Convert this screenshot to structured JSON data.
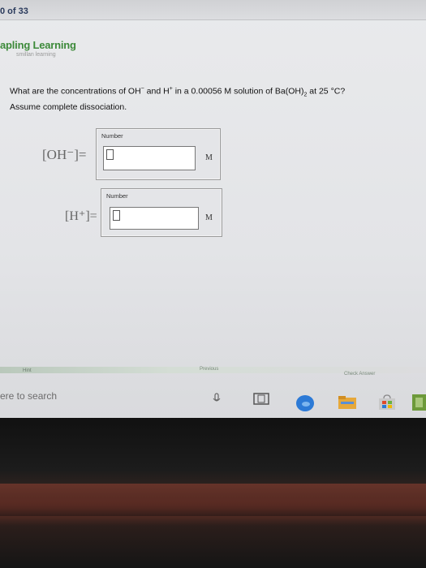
{
  "header": {
    "counter": "0 of 33"
  },
  "brand": {
    "name": "apling Learning",
    "sub": "smillan learning"
  },
  "question": {
    "text_a": "What are the concentrations of OH",
    "sup_a": "−",
    "text_b": " and H",
    "sup_b": "+",
    "text_c": " in a 0.00056 M solution of Ba(OH)",
    "sub_c": "2",
    "text_d": " at 25 °C?",
    "line2": "Assume complete dissociation."
  },
  "answers": [
    {
      "ion_label": "[OH⁻]=",
      "number_label": "Number",
      "value": "",
      "unit": "M"
    },
    {
      "ion_label": "[H⁺]=",
      "number_label": "Number",
      "value": "",
      "unit": "M"
    }
  ],
  "footer": {
    "hint": "Hint",
    "previous": "Previous",
    "check": "Check Answer",
    "search": "ere to search"
  },
  "colors": {
    "brand_green": "#3d8a3a",
    "edge_blue": "#2c7ad6",
    "taskbar_folder": "#e6a83a"
  }
}
